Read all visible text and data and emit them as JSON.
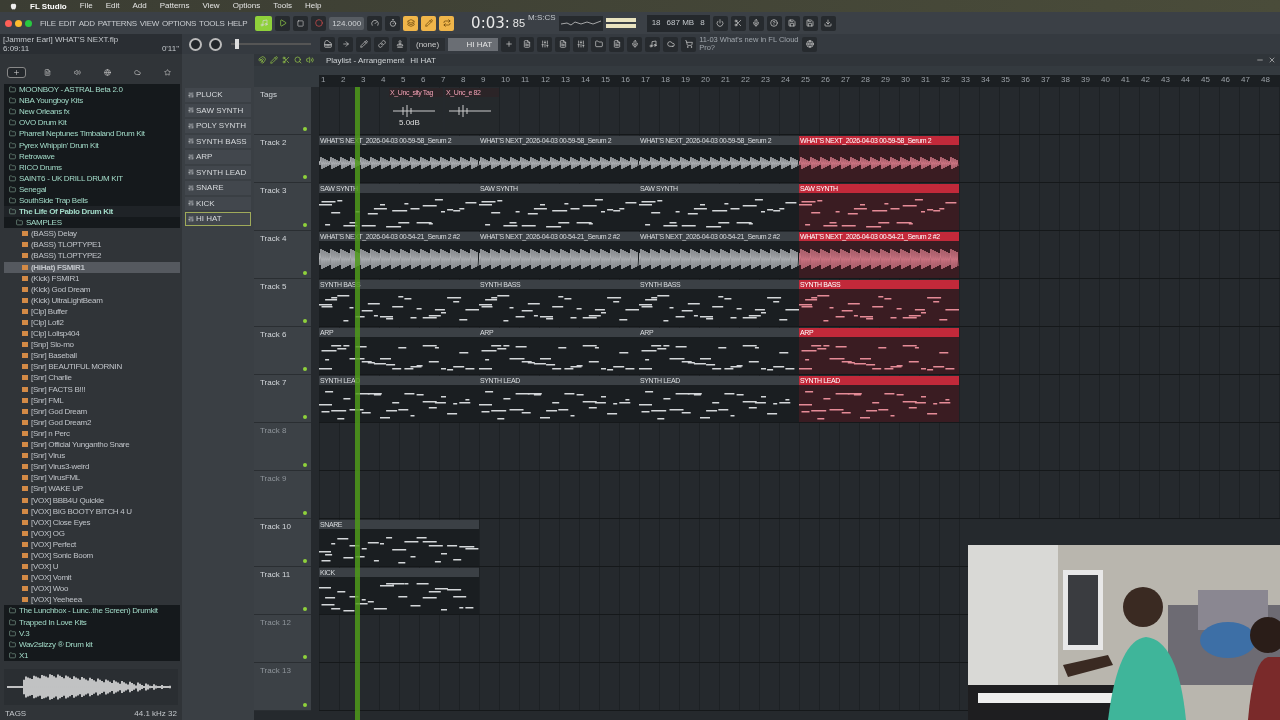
{
  "menubar": {
    "app": "FL Studio",
    "items": [
      "File",
      "Edit",
      "Add",
      "Patterns",
      "View",
      "Options",
      "Tools",
      "Help"
    ]
  },
  "toolbar": {
    "menu": [
      "FILE",
      "EDIT",
      "ADD",
      "PATTERNS",
      "VIEW",
      "OPTIONS",
      "TOOLS",
      "HELP"
    ],
    "tempo": "124.000",
    "time": "0:03:",
    "time_cs": "85",
    "time_unit": "M:S:CS",
    "cpu": "18",
    "memory": "687 MB",
    "voices": "8"
  },
  "toolbar2": {
    "master": {
      "level": 0.05
    },
    "project": "[Jammer Earl] WHAT'S NEXT.flp",
    "project_time": "6:09:11",
    "duration": "0'11\"",
    "snap": "(none)",
    "pattern": "HI HAT",
    "news": "11-03 What's new in FL Cloud Pro?"
  },
  "browser": {
    "items": [
      {
        "label": "MOONBOY - ASTRAL Beta 2.0",
        "kind": "folder",
        "selected": false
      },
      {
        "label": "NBA Youngboy Kits",
        "kind": "folder",
        "selected": false
      },
      {
        "label": "New Orleans fx",
        "kind": "folder",
        "selected": false
      },
      {
        "label": "OVO Drum Kit",
        "kind": "folder",
        "selected": false
      },
      {
        "label": "Pharrell Neptunes Timbaland Drum Kit",
        "kind": "folder",
        "selected": false
      },
      {
        "label": "Pyrex Whippin' Drum Kit",
        "kind": "folder",
        "selected": false
      },
      {
        "label": "Retrowave",
        "kind": "folder",
        "selected": false
      },
      {
        "label": "RICO Drums",
        "kind": "folder",
        "selected": false
      },
      {
        "label": "SAINT6 - UK DRILL DRUM KIT",
        "kind": "folder",
        "selected": false
      },
      {
        "label": "Senegal",
        "kind": "folder",
        "selected": false
      },
      {
        "label": "SouthSide Trap Bells",
        "kind": "folder",
        "selected": false
      },
      {
        "label": "The Life Of Pablo Drum Kit",
        "kind": "open",
        "selected": false
      },
      {
        "label": "SAMPLES",
        "kind": "subfolder",
        "selected": false
      },
      {
        "label": "(BASS) Delay",
        "kind": "file",
        "selected": false
      },
      {
        "label": "(BASS) TLOPTYPE1",
        "kind": "file",
        "selected": false
      },
      {
        "label": "(BASS) TLOPTYPE2",
        "kind": "file",
        "selected": false
      },
      {
        "label": "(HiHat) FSMIR1",
        "kind": "file",
        "selected": true
      },
      {
        "label": "(Kick) FSMIR1",
        "kind": "file",
        "selected": false
      },
      {
        "label": "(Kick) God Dream",
        "kind": "file",
        "selected": false
      },
      {
        "label": "(Kick) UltraLightBeam",
        "kind": "file",
        "selected": false
      },
      {
        "label": "[Clp] Buffer",
        "kind": "file",
        "selected": false
      },
      {
        "label": "[Clp] Lofi2",
        "kind": "file",
        "selected": false
      },
      {
        "label": "[Clp] Lolisp404",
        "kind": "file",
        "selected": false
      },
      {
        "label": "[Snp] Slo-mo",
        "kind": "file",
        "selected": false
      },
      {
        "label": "[Snr] Baseball",
        "kind": "file",
        "selected": false
      },
      {
        "label": "[Snr] BEAUTIFUL MORNIN",
        "kind": "file",
        "selected": false
      },
      {
        "label": "[Snr] Charlie",
        "kind": "file",
        "selected": false
      },
      {
        "label": "[Snr] FACTS B!!!",
        "kind": "file",
        "selected": false
      },
      {
        "label": "[Snr] FML",
        "kind": "file",
        "selected": false
      },
      {
        "label": "[Snr] God Dream",
        "kind": "file",
        "selected": false
      },
      {
        "label": "[Snr] God Dream2",
        "kind": "file",
        "selected": false
      },
      {
        "label": "[Snr] n Perc",
        "kind": "file",
        "selected": false
      },
      {
        "label": "[Snr] Official Yungantho Snare",
        "kind": "file",
        "selected": false
      },
      {
        "label": "[Snr] Virus",
        "kind": "file",
        "selected": false
      },
      {
        "label": "[Snr] Virus3-weird",
        "kind": "file",
        "selected": false
      },
      {
        "label": "[Snr] VirusFML",
        "kind": "file",
        "selected": false
      },
      {
        "label": "[Snr] WAKE UP",
        "kind": "file",
        "selected": false
      },
      {
        "label": "[VOX] BBB4U Quickie",
        "kind": "file",
        "selected": false
      },
      {
        "label": "[VOX] BIG BOOTY BITCH 4 U",
        "kind": "file",
        "selected": false
      },
      {
        "label": "[VOX] Close Eyes",
        "kind": "file",
        "selected": false
      },
      {
        "label": "[VOX] OG",
        "kind": "file",
        "selected": false
      },
      {
        "label": "[VOX] Perfect",
        "kind": "file",
        "selected": false
      },
      {
        "label": "[VOX] Sonic Boom",
        "kind": "file",
        "selected": false
      },
      {
        "label": "[VOX] U",
        "kind": "file",
        "selected": false
      },
      {
        "label": "[VOX] Vomit",
        "kind": "file",
        "selected": false
      },
      {
        "label": "[VOX] Woo",
        "kind": "file",
        "selected": false
      },
      {
        "label": "[VOX] Yeeheea",
        "kind": "file",
        "selected": false
      },
      {
        "label": "The Lunchbox - Lunc..the Screen) Drumkit",
        "kind": "folder",
        "selected": false
      },
      {
        "label": "Trapped In Love Kits",
        "kind": "folder",
        "selected": false
      },
      {
        "label": "V.3",
        "kind": "folder",
        "selected": false
      },
      {
        "label": "Wav2slizzy ® Drum kit",
        "kind": "folder",
        "selected": false
      },
      {
        "label": "X1",
        "kind": "folder",
        "selected": false
      }
    ],
    "sample_info": "44.1 kHz 32",
    "tags": "TAGS"
  },
  "channels": [
    {
      "label": "PLUCK",
      "selected": false
    },
    {
      "label": "SAW SYNTH",
      "selected": false
    },
    {
      "label": "POLY SYNTH",
      "selected": false
    },
    {
      "label": "SYNTH BASS",
      "selected": false
    },
    {
      "label": "ARP",
      "selected": false
    },
    {
      "label": "SYNTH LEAD",
      "selected": false
    },
    {
      "label": "SNARE",
      "selected": false
    },
    {
      "label": "KICK",
      "selected": false
    },
    {
      "label": "HI HAT",
      "selected": true
    }
  ],
  "playlist": {
    "title": "Playlist - Arrangement",
    "pattern": "HI HAT",
    "bars": [
      "1",
      "2",
      "3",
      "4",
      "5",
      "6",
      "7",
      "8",
      "9",
      "10",
      "11",
      "12",
      "13",
      "14",
      "15",
      "16",
      "17",
      "18",
      "19",
      "20",
      "21",
      "22",
      "23",
      "24",
      "25",
      "26",
      "27",
      "28",
      "29",
      "30",
      "31",
      "32",
      "33",
      "34",
      "35",
      "36",
      "37",
      "38",
      "39",
      "40",
      "41",
      "42",
      "43",
      "44",
      "45",
      "46",
      "47",
      "48"
    ],
    "tracks": [
      {
        "label": "Tags",
        "clips": [
          {
            "label": "X_Unc_sity Tag",
            "kind": "tag"
          },
          {
            "label": "X_Unc_e 82",
            "kind": "tag"
          }
        ],
        "gain": "5.0dB"
      },
      {
        "label": "Track 2",
        "clips": [
          {
            "label": "WHAT'S NEXT_2026-04-03 00-59-58_Serum 2",
            "kind": "audio",
            "selected": false
          },
          {
            "label": "WHAT'S NEXT_2026-04-03 00-59-58_Serum 2",
            "kind": "audio",
            "selected": false
          },
          {
            "label": "WHAT'S NEXT_2026-04-03 00-59-58_Serum 2",
            "kind": "audio",
            "selected": false
          },
          {
            "label": "WHAT'S NEXT_2026-04-03 00-59-58_Serum 2",
            "kind": "audio",
            "selected": true
          }
        ]
      },
      {
        "label": "Track 3",
        "clips": [
          {
            "label": "SAW SYNTH",
            "kind": "pattern",
            "selected": false
          },
          {
            "label": "SAW SYNTH",
            "kind": "pattern",
            "selected": false
          },
          {
            "label": "SAW SYNTH",
            "kind": "pattern",
            "selected": false
          },
          {
            "label": "SAW SYNTH",
            "kind": "pattern",
            "selected": true
          }
        ]
      },
      {
        "label": "Track 4",
        "clips": [
          {
            "label": "WHAT'S NEXT_2026-04-03 00-54-21_Serum 2 #2",
            "kind": "audio",
            "selected": false
          },
          {
            "label": "WHAT'S NEXT_2026-04-03 00-54-21_Serum 2 #2",
            "kind": "audio",
            "selected": false
          },
          {
            "label": "WHAT'S NEXT_2026-04-03 00-54-21_Serum 2 #2",
            "kind": "audio",
            "selected": false
          },
          {
            "label": "WHAT'S NEXT_2026-04-03 00-54-21_Serum 2 #2",
            "kind": "audio",
            "selected": true
          }
        ]
      },
      {
        "label": "Track 5",
        "clips": [
          {
            "label": "SYNTH BASS",
            "kind": "pattern",
            "selected": false
          },
          {
            "label": "SYNTH BASS",
            "kind": "pattern",
            "selected": false
          },
          {
            "label": "SYNTH BASS",
            "kind": "pattern",
            "selected": false
          },
          {
            "label": "SYNTH BASS",
            "kind": "pattern",
            "selected": true
          }
        ]
      },
      {
        "label": "Track 6",
        "clips": [
          {
            "label": "ARP",
            "kind": "pattern",
            "selected": false
          },
          {
            "label": "ARP",
            "kind": "pattern",
            "selected": false
          },
          {
            "label": "ARP",
            "kind": "pattern",
            "selected": false
          },
          {
            "label": "ARP",
            "kind": "pattern",
            "selected": true
          }
        ]
      },
      {
        "label": "Track 7",
        "clips": [
          {
            "label": "SYNTH LEAD",
            "kind": "pattern",
            "selected": false
          },
          {
            "label": "SYNTH LEAD",
            "kind": "pattern",
            "selected": false
          },
          {
            "label": "SYNTH LEAD",
            "kind": "pattern",
            "selected": false
          },
          {
            "label": "SYNTH LEAD",
            "kind": "pattern",
            "selected": true
          }
        ]
      },
      {
        "label": "Track 8"
      },
      {
        "label": "Track 9"
      },
      {
        "label": "Track 10",
        "clips": [
          {
            "label": "SNARE",
            "kind": "pattern",
            "selected": false
          }
        ]
      },
      {
        "label": "Track 11",
        "clips": [
          {
            "label": "KICK",
            "kind": "pattern",
            "selected": false
          }
        ]
      },
      {
        "label": "Track 12"
      },
      {
        "label": "Track 13"
      }
    ]
  }
}
